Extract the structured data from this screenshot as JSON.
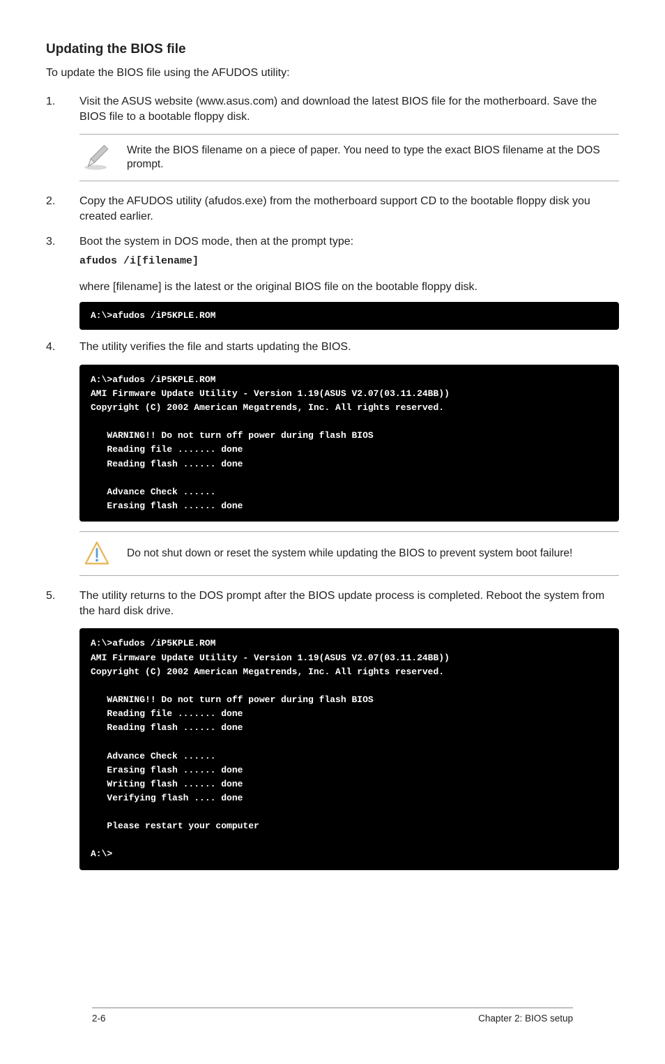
{
  "heading": "Updating the BIOS file",
  "intro": "To update the BIOS file using the AFUDOS utility:",
  "steps": {
    "s1": {
      "num": "1.",
      "text": "Visit the ASUS website (www.asus.com) and download the latest BIOS file for the motherboard. Save the BIOS file to a bootable floppy disk."
    },
    "s2": {
      "num": "2.",
      "text": "Copy the AFUDOS utility (afudos.exe) from the motherboard support CD to the bootable floppy disk you created earlier."
    },
    "s3": {
      "num": "3.",
      "line1": "Boot the system in DOS mode, then at the prompt type:",
      "cmd": "afudos /i[filename]",
      "line2": "where [filename] is the latest or the original BIOS file on the bootable floppy disk."
    },
    "s4": {
      "num": "4.",
      "text": "The utility verifies the file and starts updating the BIOS."
    },
    "s5": {
      "num": "5.",
      "text": "The utility returns to the DOS prompt after the BIOS update process is completed. Reboot the system from the hard disk drive."
    }
  },
  "callouts": {
    "note1": "Write the BIOS filename on a piece of paper. You need to type the exact BIOS filename at the DOS prompt.",
    "warn1": "Do not shut down or reset the system while updating the BIOS to prevent system boot failure!"
  },
  "terminal": {
    "t1": "A:\\>afudos /iP5KPLE.ROM",
    "t2": "A:\\>afudos /iP5KPLE.ROM\nAMI Firmware Update Utility - Version 1.19(ASUS V2.07(03.11.24BB))\nCopyright (C) 2002 American Megatrends, Inc. All rights reserved.\n\n   WARNING!! Do not turn off power during flash BIOS\n   Reading file ....... done\n   Reading flash ...... done\n\n   Advance Check ......\n   Erasing flash ...... done",
    "t3": "A:\\>afudos /iP5KPLE.ROM\nAMI Firmware Update Utility - Version 1.19(ASUS V2.07(03.11.24BB))\nCopyright (C) 2002 American Megatrends, Inc. All rights reserved.\n\n   WARNING!! Do not turn off power during flash BIOS\n   Reading file ....... done\n   Reading flash ...... done\n\n   Advance Check ......\n   Erasing flash ...... done\n   Writing flash ...... done\n   Verifying flash .... done\n\n   Please restart your computer\n\nA:\\>"
  },
  "footer": {
    "left": "2-6",
    "right": "Chapter 2: BIOS setup"
  }
}
